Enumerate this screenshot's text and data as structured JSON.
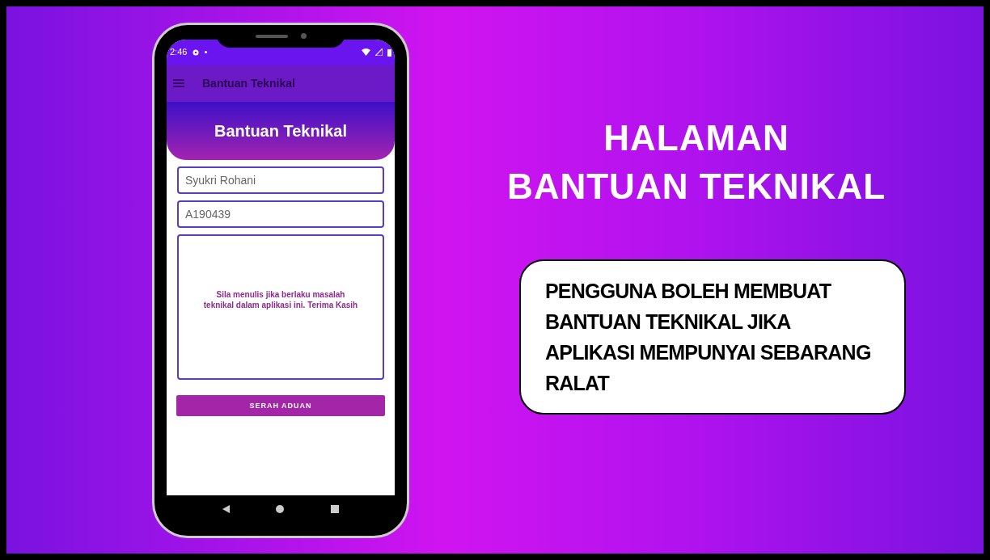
{
  "phone": {
    "status_bar": {
      "time": "2:46"
    },
    "app_bar": {
      "title": "Bantuan Teknikal"
    },
    "header": {
      "title": "Bantuan Teknikal"
    },
    "form": {
      "fields": [
        {
          "value": "Syukri Rohani"
        },
        {
          "value": "A190439"
        }
      ],
      "message": {
        "placeholder": "Sila menulis jika berlaku masalah teknikal dalam aplikasi ini. Terima Kasih"
      },
      "submit": "SERAH ADUAN"
    }
  },
  "heading": [
    "HALAMAN",
    "BANTUAN TEKNIKAL"
  ],
  "description": "PENGGUNA BOLEH MEMBUAT BANTUAN TEKNIKAL JIKA APLIKASI MEMPUNYAI SEBARANG RALAT"
}
